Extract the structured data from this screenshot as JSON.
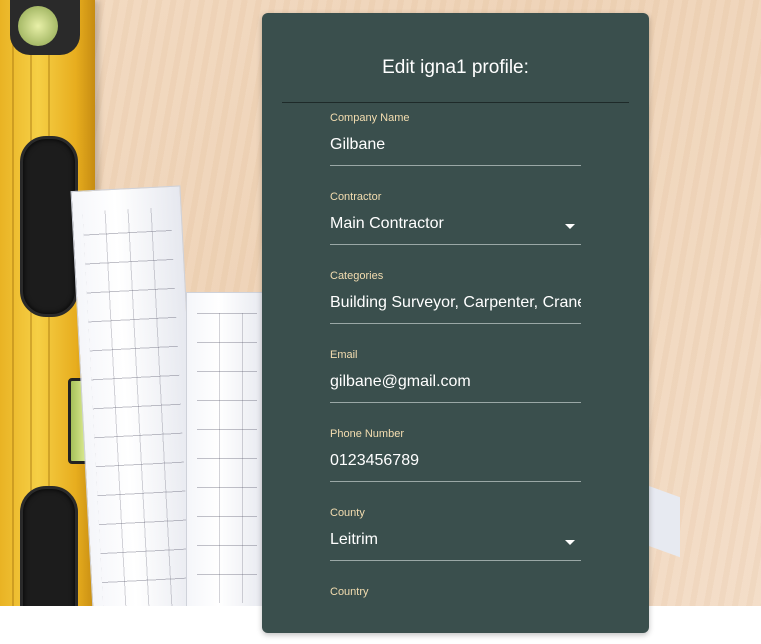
{
  "form": {
    "title": "Edit igna1 profile:",
    "fields": [
      {
        "label": "Company Name",
        "value": "Gilbane"
      },
      {
        "label": "Contractor",
        "value": "Main Contractor"
      },
      {
        "label": "Categories",
        "value": "Building Surveyor, Carpenter, Crane"
      },
      {
        "label": "Email",
        "value": "gilbane@gmail.com"
      },
      {
        "label": "Phone Number",
        "value": "0123456789"
      },
      {
        "label": "County",
        "value": "Leitrim"
      },
      {
        "label": "Country",
        "value": ""
      }
    ]
  },
  "colors": {
    "card": "#3a4f4d",
    "label": "#f3ddb0",
    "text": "#ffffff"
  }
}
